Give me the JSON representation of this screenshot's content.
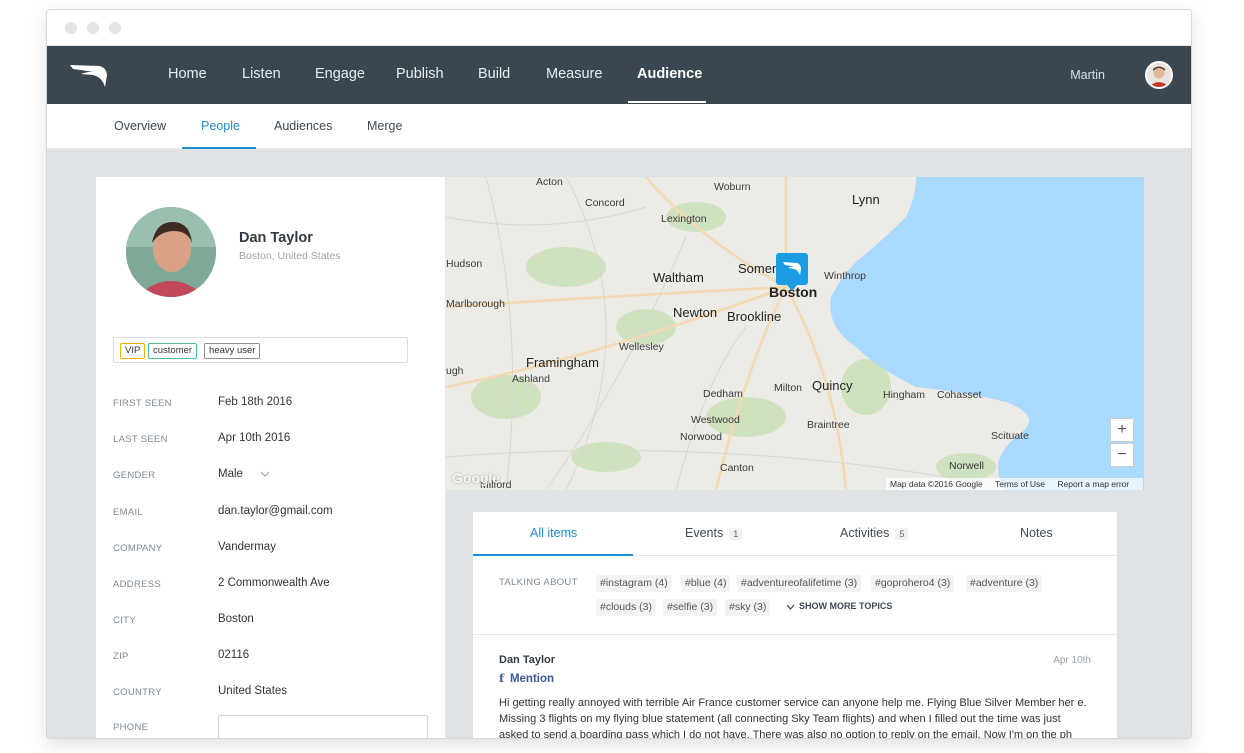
{
  "window": {
    "traffic_lights": [
      "close",
      "minimize",
      "maximize"
    ]
  },
  "navbar": {
    "logo_icon": "wing-logo-icon",
    "items": [
      "Home",
      "Listen",
      "Engage",
      "Publish",
      "Build",
      "Measure",
      "Audience"
    ],
    "active": "Audience",
    "user_name": "Martin"
  },
  "subnav": {
    "items": [
      "Overview",
      "People",
      "Audiences",
      "Merge"
    ],
    "active": "People"
  },
  "profile": {
    "name": "Dan Taylor",
    "location": "Boston, United States",
    "tags": [
      {
        "label": "VIP",
        "color": "#f0b400"
      },
      {
        "label": "customer",
        "color": "#4fbf8f"
      },
      {
        "label": "heavy user",
        "color": "#8a9298"
      }
    ],
    "fields": [
      {
        "label": "FIRST SEEN",
        "value": "Feb 18th 2016"
      },
      {
        "label": "LAST SEEN",
        "value": "Apr 10th 2016"
      },
      {
        "label": "GENDER",
        "value": "Male"
      },
      {
        "label": "EMAIL",
        "value": "dan.taylor@gmail.com"
      },
      {
        "label": "COMPANY",
        "value": "Vandermay"
      },
      {
        "label": "ADDRESS",
        "value": "2 Commonwealth Ave"
      },
      {
        "label": "CITY",
        "value": "Boston"
      },
      {
        "label": "ZIP",
        "value": "02116"
      },
      {
        "label": "COUNTRY",
        "value": "United States"
      },
      {
        "label": "PHONE",
        "value": ""
      }
    ]
  },
  "map": {
    "labels": [
      "Acton",
      "Woburn",
      "Lynn",
      "Concord",
      "Lexington",
      "Hudson",
      "Waltham",
      "Somerville",
      "Winthrop",
      "Boston",
      "Marlborough",
      "Newton",
      "Brookline",
      "Wellesley",
      "Framingham",
      "Ashland",
      "Dedham",
      "Milton",
      "Quincy",
      "Hingham",
      "Cohasset",
      "Westwood",
      "Norwood",
      "Braintree",
      "Scituate",
      "Canton",
      "Norwell",
      "Milford",
      "ugh"
    ],
    "footer": {
      "data": "Map data ©2016 Google",
      "terms": "Terms of Use",
      "report": "Report a map error"
    },
    "zoom_in": "+",
    "zoom_out": "−",
    "google_mark": "Google"
  },
  "feed": {
    "tabs": [
      {
        "label": "All items",
        "count": ""
      },
      {
        "label": "Events",
        "count": "1"
      },
      {
        "label": "Activities",
        "count": "5"
      },
      {
        "label": "Notes",
        "count": ""
      }
    ],
    "active_tab": "All items",
    "talking_about_label": "TALKING ABOUT",
    "topics": [
      "#instagram (4)",
      "#blue (4)",
      "#adventureofalifetime (3)",
      "#goprohero4 (3)",
      "#adventure (3)",
      "#clouds (3)",
      "#selfie (3)",
      "#sky (3)"
    ],
    "show_more": "SHOW MORE TOPICS",
    "post": {
      "author": "Dan Taylor",
      "type": "Mention",
      "type_icon": "facebook-icon",
      "date": "Apr 10th",
      "text": "Hi getting really annoyed with terrible Air France customer service can anyone help me. Flying Blue Silver Member her e. Missing 3 flights on my flying blue statement (all connecting Sky Team flights) and when I filled out the time was just asked to send a boarding pass which I do not have. There was also no option to reply on the email. Now I'm on the ph"
    }
  }
}
